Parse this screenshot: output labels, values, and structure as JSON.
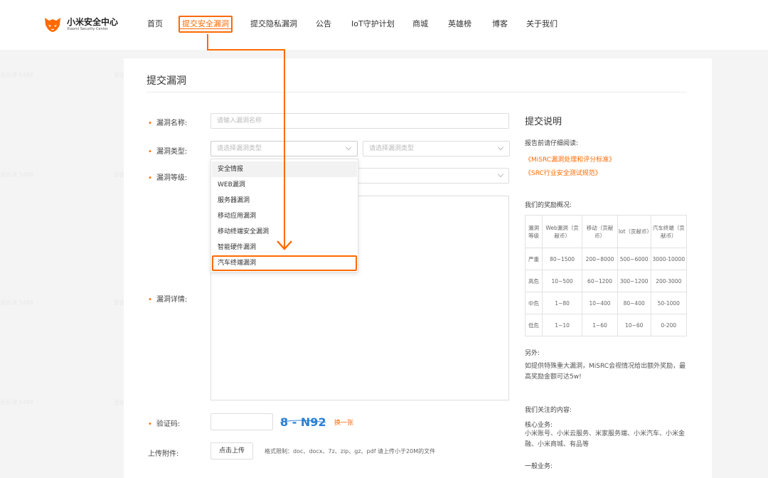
{
  "brand": {
    "cn": "小米安全中心",
    "en": "Xiaomi Security Center"
  },
  "nav": [
    "首页",
    "提交安全漏洞",
    "提交隐私漏洞",
    "公告",
    "IoT守护计划",
    "商城",
    "英雄榜",
    "博客",
    "关于我们"
  ],
  "nav_active_index": 1,
  "form": {
    "title": "提交漏洞",
    "name_label": "漏洞名称:",
    "name_placeholder": "请输入漏洞名称",
    "type_label": "漏洞类型:",
    "type_placeholder": "请选择漏洞类型",
    "subtype_placeholder": "请选择漏洞类型",
    "level_label": "漏洞等级:",
    "detail_label": "漏洞详情:",
    "captcha_label": "验证码:",
    "captcha_image_text": "8 - N92",
    "refresh_label": "换一张",
    "attach_label": "上传附件:",
    "upload_button": "点击上传",
    "upload_hint": "格式限制：doc、docx、7z、zip、gz、pdf 请上传小于20M的文件",
    "required_mark": "•"
  },
  "dropdown": {
    "options": [
      "安全情报",
      "WEB漏洞",
      "服务器漏洞",
      "移动应用漏洞",
      "移动终端安全漏洞",
      "智能硬件漏洞",
      "汽车终端漏洞"
    ],
    "hover_index": 0,
    "highlight_index": 6
  },
  "panel": {
    "title": "提交说明",
    "read_first": "报告前请仔细阅读:",
    "link1": "《MiSRC漏洞处理和评分标准》",
    "link2": "《SRC行业安全测试规范》",
    "reward_title": "我们的奖励概况:",
    "table_headers": [
      "漏洞等级",
      "Web漏洞（贡献币）",
      "移动（贡献币）",
      "Iot（贡献币）",
      "汽车终端（贡献币）"
    ],
    "table_rows": [
      [
        "严重",
        "80~1500",
        "200~8000",
        "500~6000",
        "3000-10000"
      ],
      [
        "高危",
        "10~500",
        "60~1200",
        "300~1200",
        "200-3000"
      ],
      [
        "中危",
        "1~80",
        "10~400",
        "80~400",
        "50-1000"
      ],
      [
        "低危",
        "1~10",
        "1~60",
        "10~60",
        "0-200"
      ]
    ],
    "extra_title": "另外:",
    "extra_text": "如提供特殊重大漏洞，MiSRC会视情况给出额外奖励，最高奖励金额可达5w!",
    "focus_title": "我们关注的内容:",
    "core_title": "核心业务:",
    "core_text": "小米账号、小米云服务、米家服务端、小米汽车、小米金融、小米商城、有品等",
    "general_title": "一般业务:"
  },
  "watermark": "张云涛 5488",
  "colors": {
    "accent": "#ff6a00",
    "background": "#f4f4f4",
    "card": "#ffffff"
  }
}
